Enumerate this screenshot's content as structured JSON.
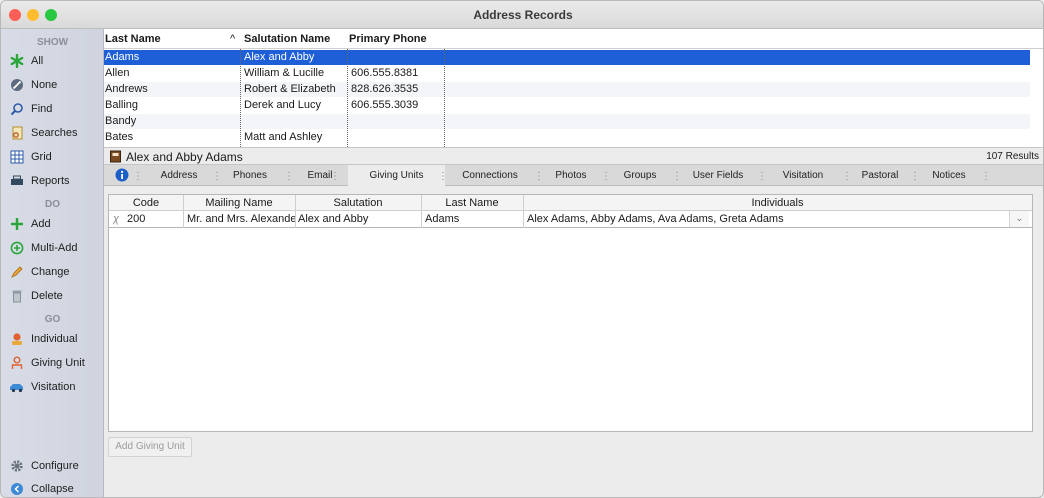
{
  "window": {
    "title": "Address Records"
  },
  "sidebar": {
    "show_header": "SHOW",
    "do_header": "DO",
    "go_header": "GO",
    "show": [
      {
        "label": "All",
        "icon": "asterisk-icon"
      },
      {
        "label": "None",
        "icon": "none-icon"
      },
      {
        "label": "Find",
        "icon": "magnifier-icon"
      },
      {
        "label": "Searches",
        "icon": "searches-icon"
      },
      {
        "label": "Grid",
        "icon": "grid-icon"
      },
      {
        "label": "Reports",
        "icon": "printer-icon"
      }
    ],
    "do": [
      {
        "label": "Add",
        "icon": "plus-icon"
      },
      {
        "label": "Multi-Add",
        "icon": "multi-add-icon"
      },
      {
        "label": "Change",
        "icon": "pencil-icon"
      },
      {
        "label": "Delete",
        "icon": "trash-icon"
      }
    ],
    "go": [
      {
        "label": "Individual",
        "icon": "individual-icon"
      },
      {
        "label": "Giving Unit",
        "icon": "giving-unit-icon"
      },
      {
        "label": "Visitation",
        "icon": "car-icon"
      }
    ],
    "configure": "Configure",
    "collapse": "Collapse"
  },
  "grid": {
    "columns": [
      "Last Name",
      "^",
      "Salutation Name",
      "Primary Phone"
    ],
    "rows": [
      {
        "last": "Adams",
        "salutation": "Alex and Abby",
        "phone": ""
      },
      {
        "last": "Allen",
        "salutation": "William & Lucille",
        "phone": "606.555.8381"
      },
      {
        "last": "Andrews",
        "salutation": "Robert & Elizabeth",
        "phone": "828.626.3535"
      },
      {
        "last": "Balling",
        "salutation": "Derek and Lucy",
        "phone": "606.555.3039"
      },
      {
        "last": "Bandy",
        "salutation": "",
        "phone": ""
      },
      {
        "last": "Bates",
        "salutation": "Matt and Ashley",
        "phone": ""
      }
    ]
  },
  "record": {
    "name": "Alex and Abby Adams",
    "count": "107 Results"
  },
  "tabs": [
    "Address",
    "Phones",
    "Email",
    "Giving Units",
    "Connections",
    "Photos",
    "Groups",
    "User Fields",
    "Visitation",
    "Pastoral",
    "Notices"
  ],
  "detail": {
    "columns": [
      "Code",
      "Mailing Name",
      "Salutation",
      "Last Name",
      "Individuals"
    ],
    "row": {
      "code": "200",
      "mailing": "Mr. and Mrs. Alexander",
      "salutation": "Alex and Abby",
      "last": "Adams",
      "individuals": "Alex Adams, Abby Adams, Ava Adams, Greta Adams"
    }
  },
  "add_button": "Add Giving Unit",
  "colors": {
    "selection": "#1e5fd7",
    "close": "#ff5f57",
    "minimize": "#febc2e",
    "zoom": "#28c840"
  }
}
